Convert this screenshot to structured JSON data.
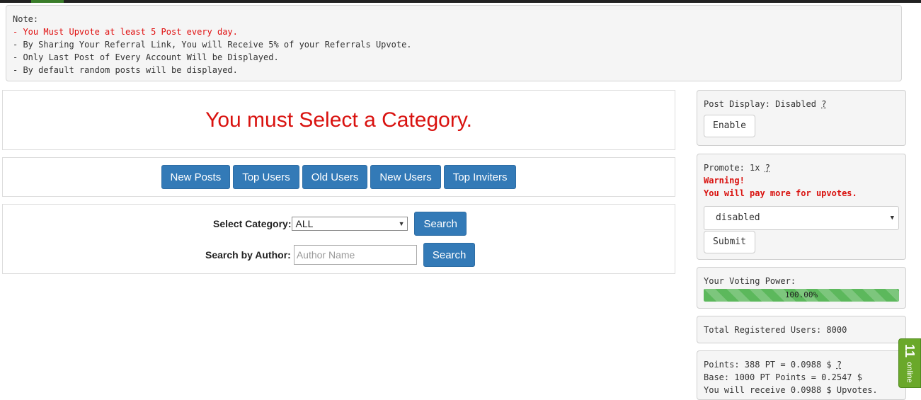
{
  "note": {
    "title": "Note:",
    "lines": [
      "- You Must Upvote at least 5 Post every day.",
      "- By Sharing Your Referral Link, You will Receive 5% of your Referrals Upvote.",
      "- Only Last Post of Every Account Will be Displayed.",
      "- By default random posts will be displayed."
    ]
  },
  "main": {
    "must_select": "You must Select a Category.",
    "nav": [
      "New Posts",
      "Top Users",
      "Old Users",
      "New Users",
      "Top Inviters"
    ],
    "search": {
      "category_label": "Select Category:",
      "category_value": "ALL",
      "search_label": "Search",
      "author_label": "Search by Author:",
      "author_placeholder": "Author Name"
    }
  },
  "sidebar": {
    "post_display": {
      "text": "Post Display: Disabled",
      "help": "?",
      "button": "Enable"
    },
    "promote": {
      "text": "Promote: 1x",
      "help": "?",
      "warning": "Warning!",
      "warning_text": "You will pay more for upvotes.",
      "dropdown_value": "disabled",
      "submit": "Submit"
    },
    "voting": {
      "label": "Your Voting Power:",
      "percent_text": "100.00%",
      "value": 100
    },
    "registered": "Total Registered Users: 8000",
    "points": {
      "line1": "Points: 388 PT = 0.0988 $",
      "help": "?",
      "line2": "Base: 1000 PT Points = 0.2547 $",
      "line3": "You will receive 0.0988 $ Upvotes."
    }
  },
  "online_widget": {
    "count": "11",
    "label": "online"
  },
  "colors": {
    "primary": "#337ab7",
    "danger": "#d9120f",
    "success": "#5cb85c"
  }
}
